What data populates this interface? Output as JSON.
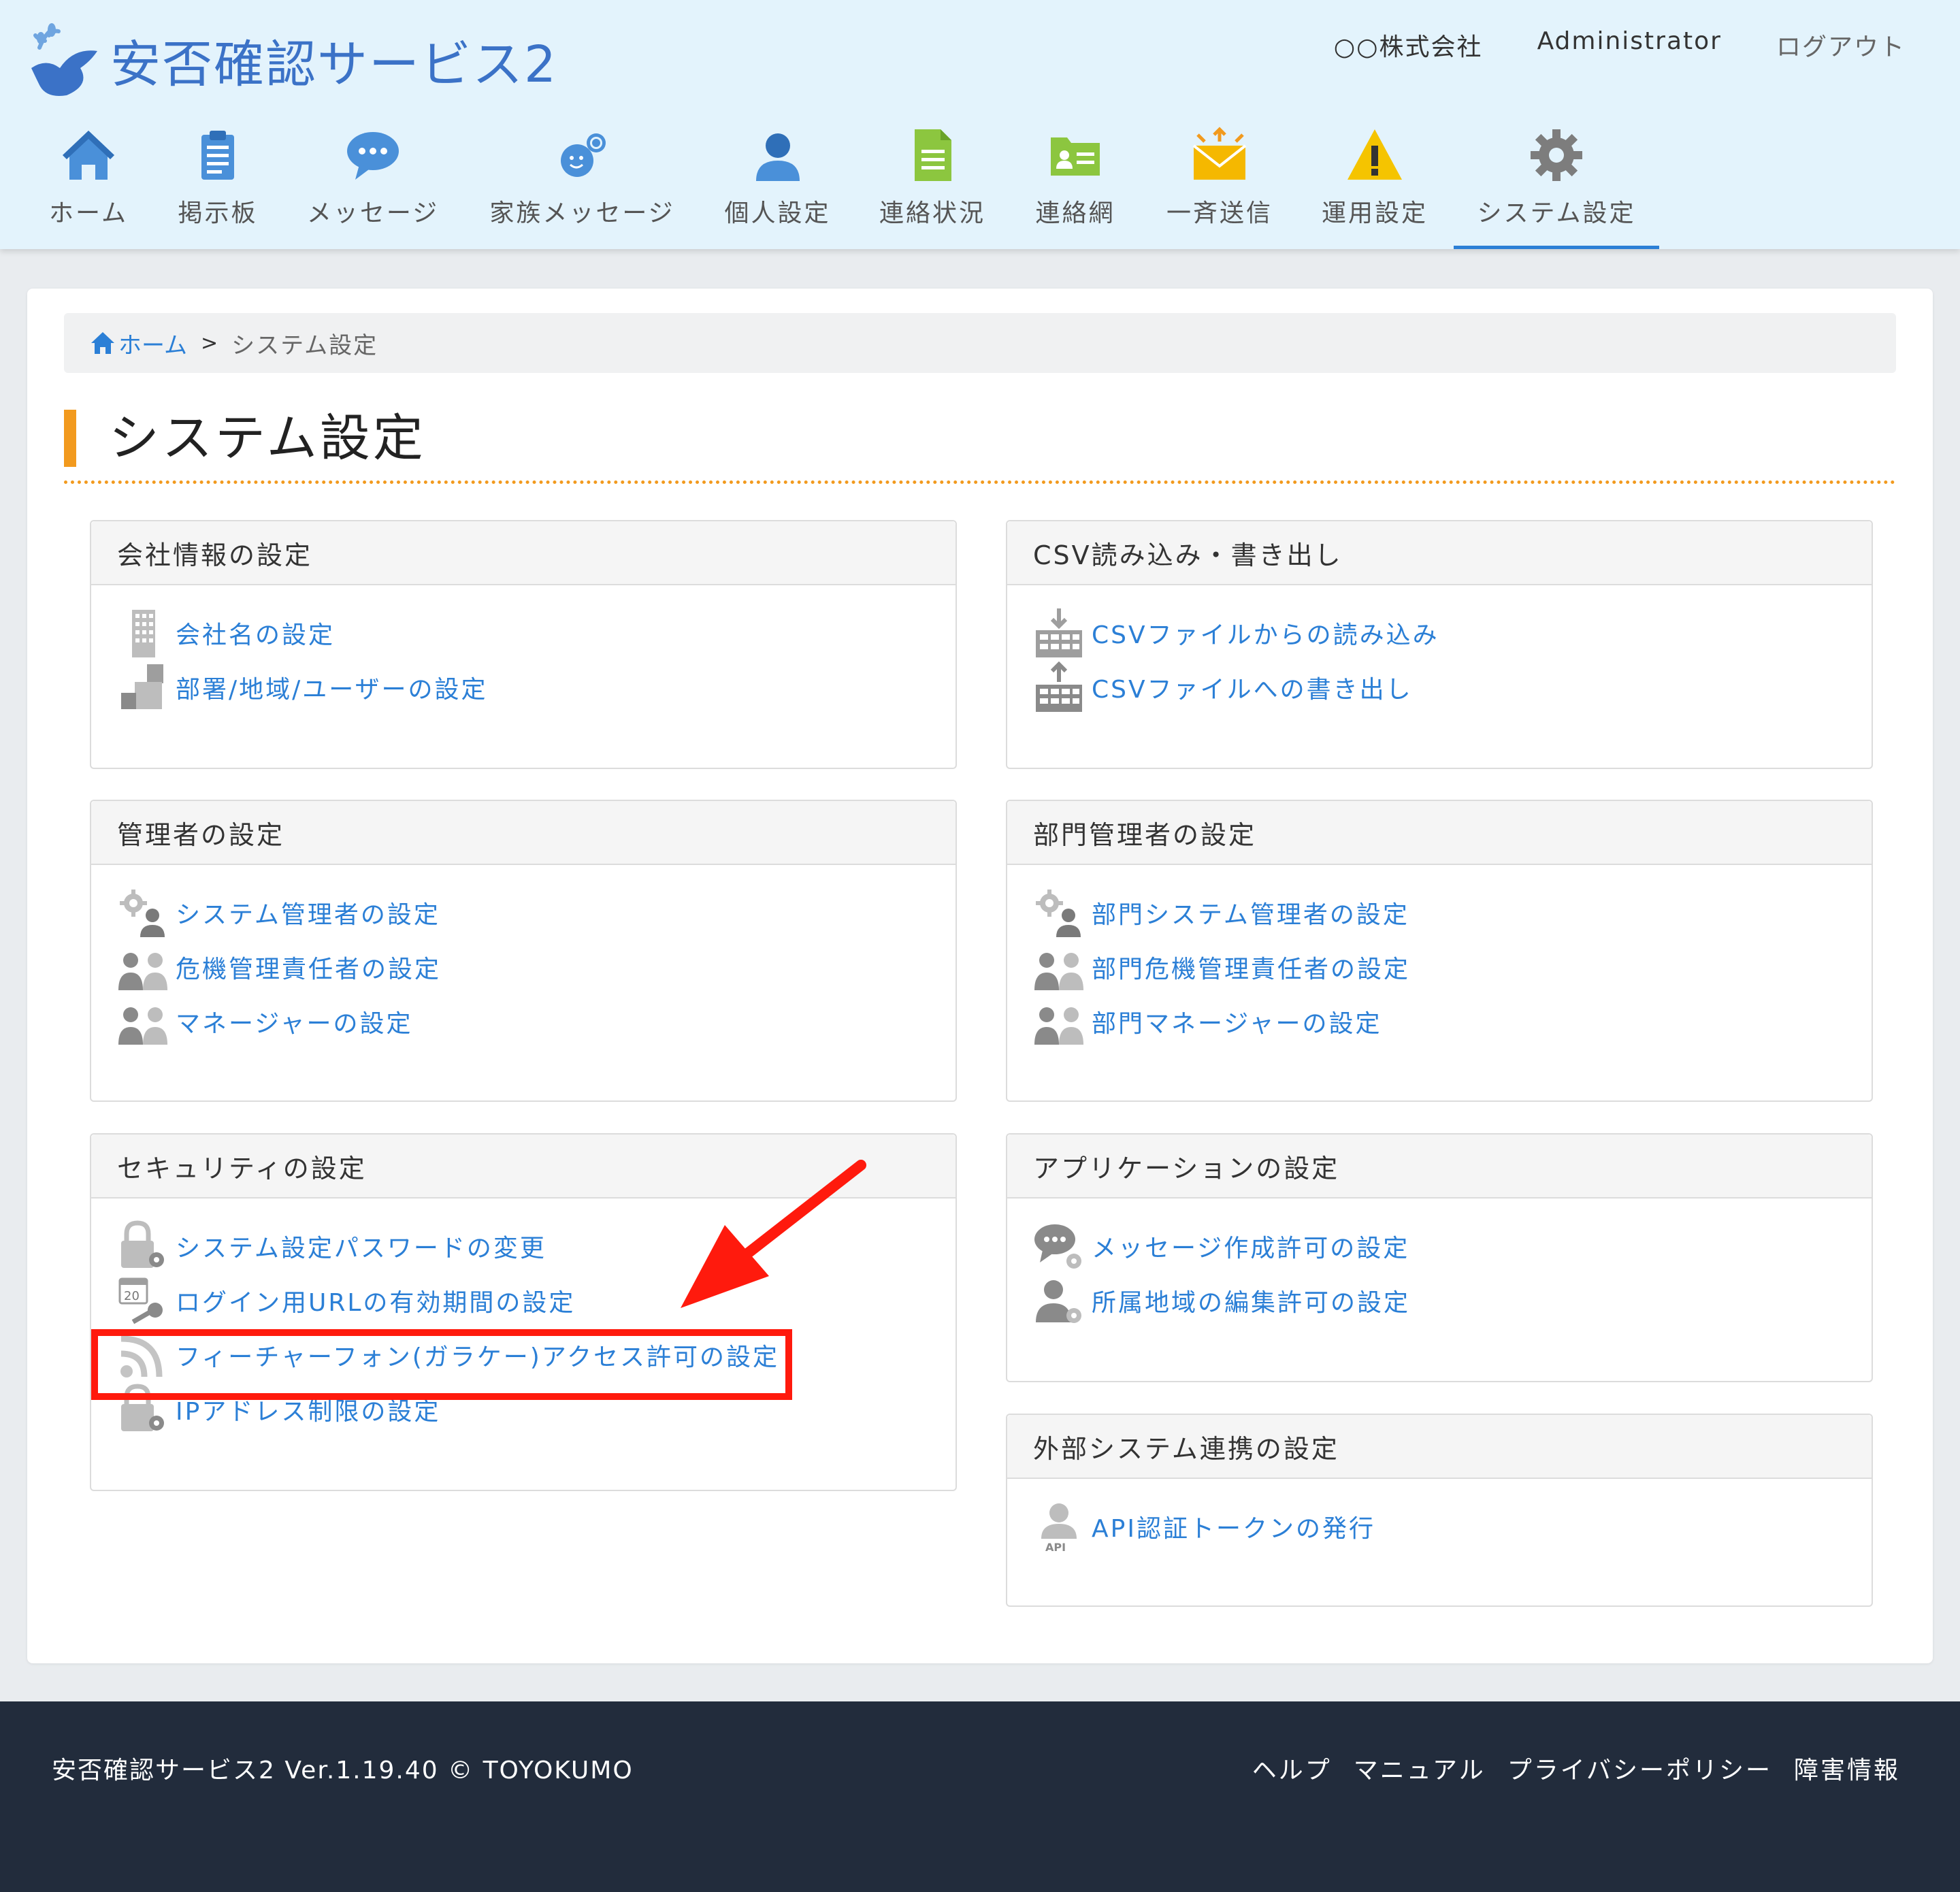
{
  "header": {
    "logo_text": "安否確認サービス2",
    "company": "○○株式会社",
    "user": "Administrator",
    "logout": "ログアウト"
  },
  "nav": [
    {
      "label": "ホーム",
      "icon": "home-icon"
    },
    {
      "label": "掲示板",
      "icon": "clipboard-icon"
    },
    {
      "label": "メッセージ",
      "icon": "chat-bubble-icon"
    },
    {
      "label": "家族メッセージ",
      "icon": "family-chat-icon"
    },
    {
      "label": "個人設定",
      "icon": "person-icon"
    },
    {
      "label": "連絡状況",
      "icon": "document-icon"
    },
    {
      "label": "連絡網",
      "icon": "address-card-icon"
    },
    {
      "label": "一斉送信",
      "icon": "envelope-icon"
    },
    {
      "label": "運用設定",
      "icon": "warning-icon"
    },
    {
      "label": "システム設定",
      "icon": "gear-icon",
      "active": true
    }
  ],
  "breadcrumb": {
    "home": "ホーム",
    "sep": ">",
    "current": "システム設定"
  },
  "page_title": "システム設定",
  "sections": {
    "company": {
      "title": "会社情報の設定",
      "items": [
        {
          "label": "会社名の設定",
          "icon": "building-icon"
        },
        {
          "label": "部署/地域/ユーザーの設定",
          "icon": "organization-icon"
        }
      ]
    },
    "csv": {
      "title": "CSV読み込み・書き出し",
      "items": [
        {
          "label": "CSVファイルからの読み込み",
          "icon": "csv-import-icon"
        },
        {
          "label": "CSVファイルへの書き出し",
          "icon": "csv-export-icon"
        }
      ]
    },
    "admin": {
      "title": "管理者の設定",
      "items": [
        {
          "label": "システム管理者の設定",
          "icon": "admin-gear-icon"
        },
        {
          "label": "危機管理責任者の設定",
          "icon": "people-icon"
        },
        {
          "label": "マネージャーの設定",
          "icon": "people-icon"
        }
      ]
    },
    "dept_admin": {
      "title": "部門管理者の設定",
      "items": [
        {
          "label": "部門システム管理者の設定",
          "icon": "admin-gear-icon"
        },
        {
          "label": "部門危機管理責任者の設定",
          "icon": "people-icon"
        },
        {
          "label": "部門マネージャーの設定",
          "icon": "people-icon"
        }
      ]
    },
    "security": {
      "title": "セキュリティの設定",
      "items": [
        {
          "label": "システム設定パスワードの変更",
          "icon": "lock-gear-icon"
        },
        {
          "label": "ログイン用URLの有効期間の設定",
          "icon": "calendar-key-icon"
        },
        {
          "label": "フィーチャーフォン(ガラケー)アクセス許可の設定",
          "icon": "rss-icon"
        },
        {
          "label": "IPアドレス制限の設定",
          "icon": "lock-gear-icon"
        }
      ]
    },
    "application": {
      "title": "アプリケーションの設定",
      "items": [
        {
          "label": "メッセージ作成許可の設定",
          "icon": "chat-gear-icon"
        },
        {
          "label": "所属地域の編集許可の設定",
          "icon": "person-gear-icon"
        }
      ]
    },
    "external": {
      "title": "外部システム連携の設定",
      "items": [
        {
          "label": "API認証トークンの発行",
          "icon": "api-person-icon"
        }
      ]
    }
  },
  "footer": {
    "copyright": "安否確認サービス2 Ver.1.19.40 © TOYOKUMO",
    "links": [
      "ヘルプ",
      "マニュアル",
      "プライバシーポリシー",
      "障害情報"
    ]
  },
  "colors": {
    "accent_blue": "#2b7fd6",
    "header_bg": "#e3f3fc",
    "title_orange": "#f29a1e",
    "highlight_red": "#ff1a0d",
    "footer_bg": "#222c3c"
  }
}
